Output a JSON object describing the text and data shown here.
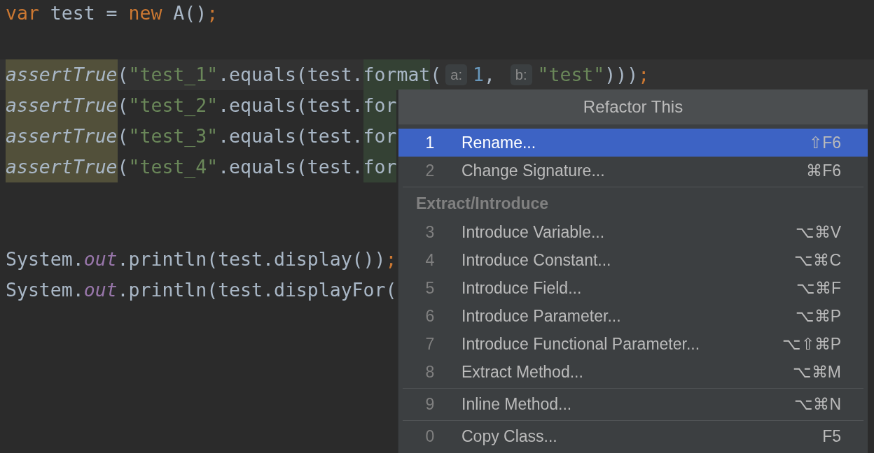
{
  "editor": {
    "lines": [
      {
        "kind": "code",
        "tokens": [
          {
            "text": "var",
            "kind": "keyword"
          },
          {
            "text": " test = ",
            "kind": "plain"
          },
          {
            "text": "new",
            "kind": "keyword"
          },
          {
            "text": " A()",
            "kind": "plain"
          },
          {
            "text": ";",
            "kind": "keyword"
          }
        ]
      },
      {
        "kind": "blank"
      },
      {
        "kind": "current",
        "tokens": [
          {
            "text": "assertTrue",
            "kind": "usage"
          },
          {
            "text": "(",
            "kind": "plain"
          },
          {
            "text": "\"test_1\"",
            "kind": "string"
          },
          {
            "text": ".equals(test.",
            "kind": "plain"
          },
          {
            "text": "format",
            "kind": "target"
          },
          {
            "text": "(",
            "kind": "plain"
          },
          {
            "text": "a:",
            "kind": "hint"
          },
          {
            "text": "1",
            "kind": "number"
          },
          {
            "text": ", ",
            "kind": "plain"
          },
          {
            "text": "b:",
            "kind": "hint"
          },
          {
            "text": "\"test\"",
            "kind": "string"
          },
          {
            "text": ")))",
            "kind": "plain"
          },
          {
            "text": ";",
            "kind": "keyword"
          }
        ]
      },
      {
        "kind": "code",
        "tokens": [
          {
            "text": "assertTrue",
            "kind": "usage"
          },
          {
            "text": "(",
            "kind": "plain"
          },
          {
            "text": "\"test_2\"",
            "kind": "string"
          },
          {
            "text": ".equals(test.",
            "kind": "plain"
          },
          {
            "text": "for",
            "kind": "target"
          }
        ]
      },
      {
        "kind": "code",
        "tokens": [
          {
            "text": "assertTrue",
            "kind": "usage"
          },
          {
            "text": "(",
            "kind": "plain"
          },
          {
            "text": "\"test_3\"",
            "kind": "string"
          },
          {
            "text": ".equals(test.",
            "kind": "plain"
          },
          {
            "text": "for",
            "kind": "target"
          }
        ]
      },
      {
        "kind": "code",
        "tokens": [
          {
            "text": "assertTrue",
            "kind": "usage"
          },
          {
            "text": "(",
            "kind": "plain"
          },
          {
            "text": "\"test_4\"",
            "kind": "string"
          },
          {
            "text": ".equals(test.",
            "kind": "plain"
          },
          {
            "text": "for",
            "kind": "target"
          }
        ]
      },
      {
        "kind": "blank"
      },
      {
        "kind": "blank"
      },
      {
        "kind": "code",
        "tokens": [
          {
            "text": "System.",
            "kind": "plain"
          },
          {
            "text": "out",
            "kind": "field"
          },
          {
            "text": ".println(test.display())",
            "kind": "plain"
          },
          {
            "text": ";",
            "kind": "keyword"
          }
        ]
      },
      {
        "kind": "code",
        "tokens": [
          {
            "text": "System.",
            "kind": "plain"
          },
          {
            "text": "out",
            "kind": "field"
          },
          {
            "text": ".println(test.displayFor(",
            "kind": "plain"
          }
        ]
      }
    ]
  },
  "popup": {
    "title": "Refactor This",
    "sections": [
      {
        "items": [
          {
            "number": "1",
            "label": "Rename...",
            "shortcut": "⇧F6",
            "selected": true
          },
          {
            "number": "2",
            "label": "Change Signature...",
            "shortcut": "⌘F6",
            "selected": false
          }
        ]
      },
      {
        "header": "Extract/Introduce",
        "items": [
          {
            "number": "3",
            "label": "Introduce Variable...",
            "shortcut": "⌥⌘V",
            "selected": false
          },
          {
            "number": "4",
            "label": "Introduce Constant...",
            "shortcut": "⌥⌘C",
            "selected": false
          },
          {
            "number": "5",
            "label": "Introduce Field...",
            "shortcut": "⌥⌘F",
            "selected": false
          },
          {
            "number": "6",
            "label": "Introduce Parameter...",
            "shortcut": "⌥⌘P",
            "selected": false
          },
          {
            "number": "7",
            "label": "Introduce Functional Parameter...",
            "shortcut": "⌥⇧⌘P",
            "selected": false
          },
          {
            "number": "8",
            "label": "Extract Method...",
            "shortcut": "⌥⌘M",
            "selected": false
          }
        ]
      },
      {
        "items": [
          {
            "number": "9",
            "label": "Inline Method...",
            "shortcut": "⌥⌘N",
            "selected": false
          }
        ]
      },
      {
        "items": [
          {
            "number": "0",
            "label": "Copy Class...",
            "shortcut": "F5",
            "selected": false
          }
        ]
      }
    ]
  }
}
